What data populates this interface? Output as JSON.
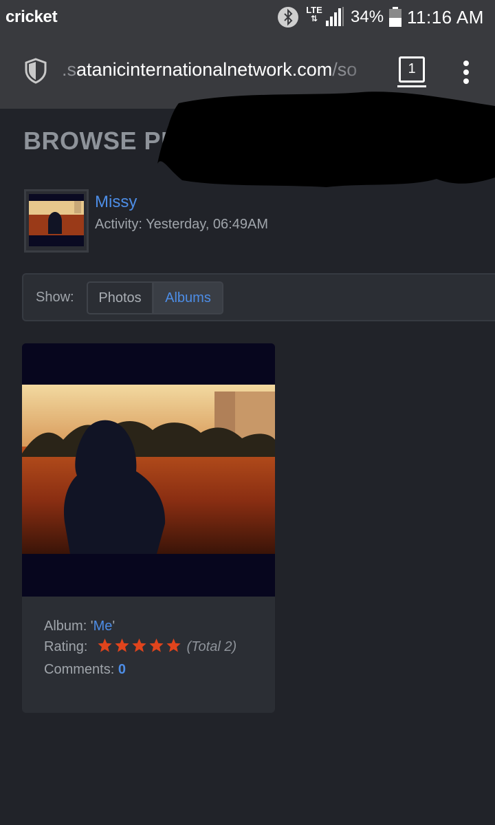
{
  "status_bar": {
    "carrier": "cricket",
    "network": "LTE",
    "battery": "34%",
    "time": "11:16 AM"
  },
  "browser": {
    "url_prefix": ".s",
    "url_main": "atanicinternationalnetwork.com",
    "url_suffix": "/so",
    "tab_count": "1"
  },
  "page": {
    "title": "BROWSE PI",
    "profile": {
      "name": "Missy",
      "activity": "Activity: Yesterday, 06:49AM"
    },
    "show_filter": {
      "label": "Show:",
      "options": [
        "Photos",
        "Albums"
      ],
      "selected": "Albums"
    },
    "album": {
      "album_label": "Album: '",
      "album_name": "Me",
      "album_close": "'",
      "rating_label": "Rating:",
      "rating_value": 5,
      "rating_max": 5,
      "rating_total": "(Total 2)",
      "comments_label": "Comments:",
      "comments_count": "0"
    }
  },
  "colors": {
    "link": "#4d8de6",
    "background": "#212329",
    "star": "#e0441c"
  }
}
